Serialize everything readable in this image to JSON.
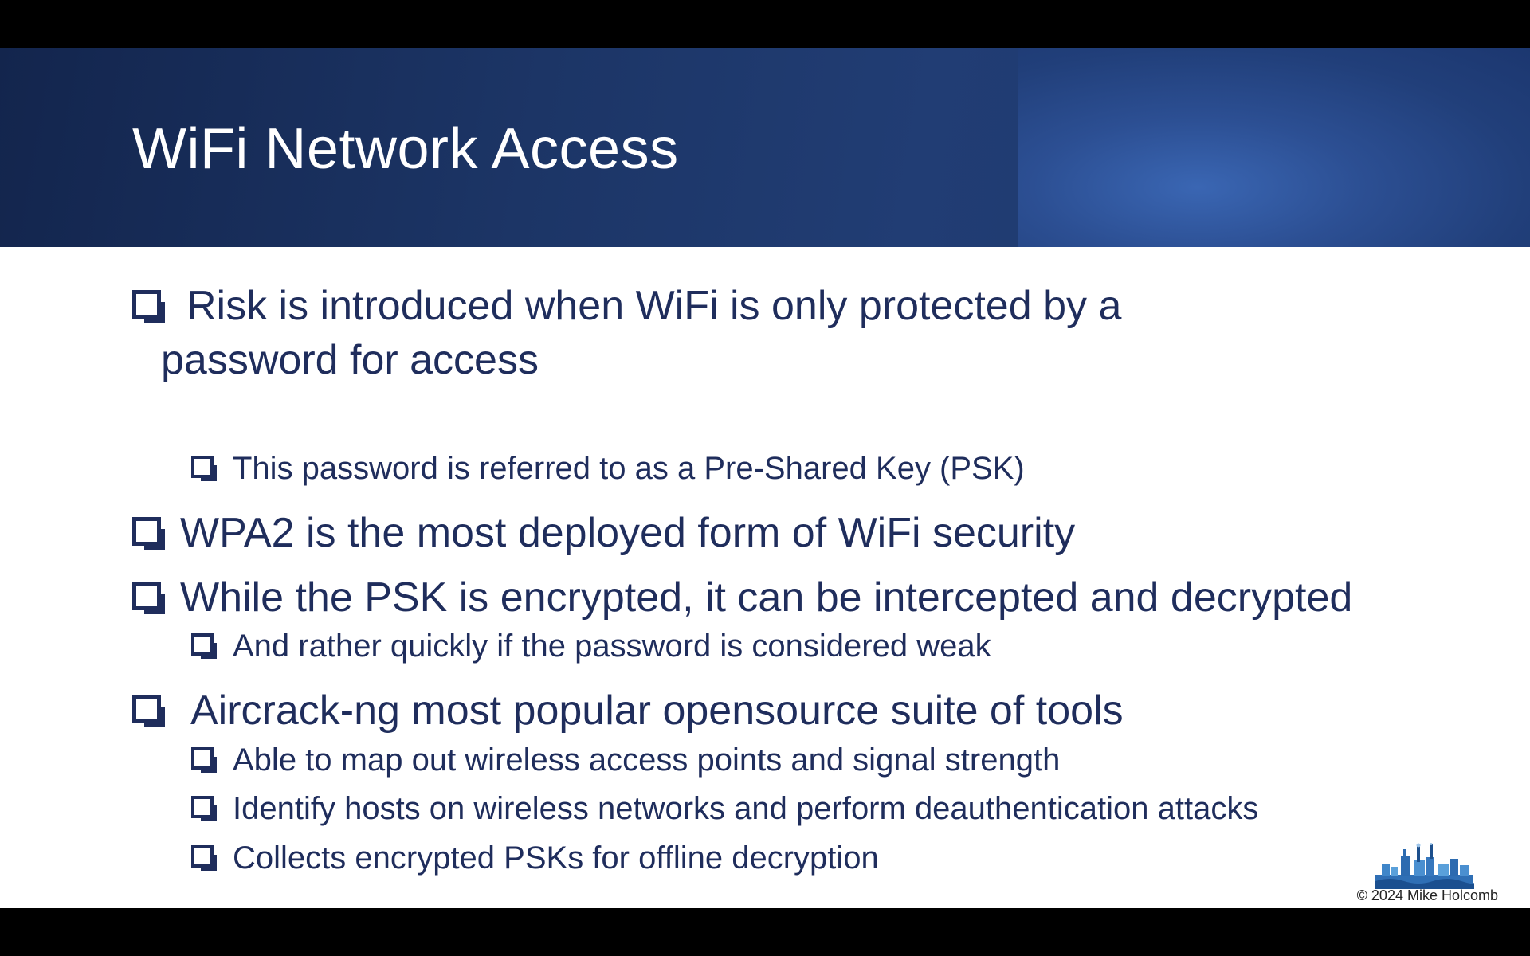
{
  "slide": {
    "title": "WiFi Network Access",
    "bullets": [
      {
        "level": 1,
        "text_line1": "Risk is introduced when WiFi is only protected by a",
        "text_line2": "password for access"
      },
      {
        "level": 2,
        "text": "This password is referred to as a Pre-Shared Key (PSK)"
      },
      {
        "level": 1,
        "text": "WPA2 is the most deployed form of WiFi security"
      },
      {
        "level": 1,
        "text": "While the PSK is encrypted, it can be intercepted and decrypted"
      },
      {
        "level": 2,
        "text": "And rather quickly if the password is considered weak"
      },
      {
        "level": 1,
        "text": "Aircrack-ng most popular opensource suite of tools"
      },
      {
        "level": 2,
        "text": "Able to map out wireless access points and signal strength"
      },
      {
        "level": 2,
        "text": "Identify hosts on wireless networks and perform deauthentication attacks"
      },
      {
        "level": 2,
        "text": "Collects encrypted PSKs for offline decryption"
      }
    ],
    "footer": {
      "copyright": "© 2024 Mike Holcomb",
      "logo_icon": "industrial-skyline-logo"
    }
  },
  "colors": {
    "title_band": "#1c3566",
    "title_text": "#ffffff",
    "body_text": "#1f2d5c",
    "background": "#ffffff"
  }
}
